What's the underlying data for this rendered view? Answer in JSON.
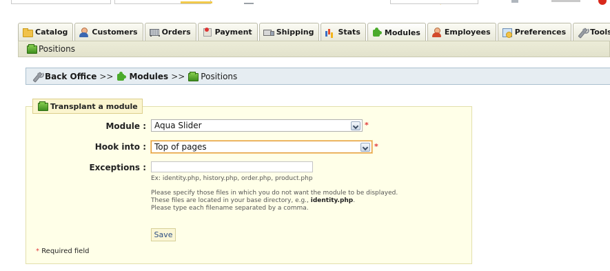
{
  "tabs": [
    {
      "label": "Catalog",
      "icon": "folder-icon"
    },
    {
      "label": "Customers",
      "icon": "customers-icon"
    },
    {
      "label": "Orders",
      "icon": "orders-icon"
    },
    {
      "label": "Payment",
      "icon": "payment-icon"
    },
    {
      "label": "Shipping",
      "icon": "shipping-icon"
    },
    {
      "label": "Stats",
      "icon": "stats-icon"
    },
    {
      "label": "Modules",
      "icon": "modules-icon",
      "active": true
    },
    {
      "label": "Employees",
      "icon": "employees-icon"
    },
    {
      "label": "Preferences",
      "icon": "preferences-icon"
    },
    {
      "label": "Tools",
      "icon": "tools-icon"
    }
  ],
  "subtab": {
    "label": "Positions",
    "icon": "positions-icon"
  },
  "breadcrumb": {
    "items": [
      "Back Office",
      "Modules",
      "Positions"
    ],
    "separator": ">>"
  },
  "form": {
    "legend": "Transplant a module",
    "module_label": "Module :",
    "module_value": "Aqua Slider",
    "hook_label": "Hook into :",
    "hook_value": "Top of pages",
    "exceptions_label": "Exceptions :",
    "exceptions_value": "",
    "exceptions_example": "Ex: identity.php, history.php, order.php, product.php",
    "help_line1": "Please specify those files in which you do not want the module to be displayed.",
    "help_line2_prefix": "These files are located in your base directory, e.g., ",
    "help_line2_bold": "identity.php",
    "help_line2_suffix": ".",
    "help_line3": "Please type each filename separated by a comma.",
    "required_marker": "*",
    "save_label": "Save",
    "required_note": "Required field"
  },
  "colors": {
    "required": "#e03a3a",
    "fieldset_bg": "#ffffe8",
    "breadcrumb_bg": "#e6edf2"
  }
}
